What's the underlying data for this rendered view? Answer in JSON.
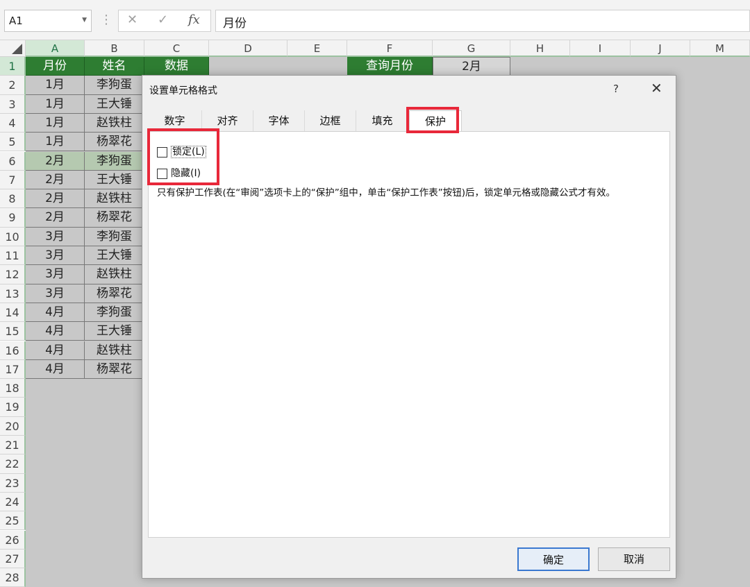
{
  "formula_bar": {
    "name_box": "A1",
    "cancel_icon": "✕",
    "enter_icon": "✓",
    "fx_label": "fx",
    "formula_value": "月份"
  },
  "columns": [
    "A",
    "B",
    "C",
    "D",
    "E",
    "F",
    "G",
    "H",
    "I",
    "J",
    "M"
  ],
  "rows": [
    "1",
    "2",
    "3",
    "4",
    "5",
    "6",
    "7",
    "8",
    "9",
    "10",
    "11",
    "12",
    "13",
    "14",
    "15",
    "16",
    "17",
    "18",
    "19",
    "20",
    "21",
    "22",
    "23",
    "24",
    "25",
    "26",
    "27",
    "28"
  ],
  "sheet": {
    "header_month": "月份",
    "header_name": "姓名",
    "header_data": "数据",
    "query_label": "查询月份",
    "query_value": "2月",
    "months": [
      "1月",
      "1月",
      "1月",
      "1月",
      "2月",
      "2月",
      "2月",
      "2月",
      "3月",
      "3月",
      "3月",
      "3月",
      "4月",
      "4月",
      "4月",
      "4月"
    ],
    "names": [
      "李狗蛋",
      "王大锤",
      "赵铁柱",
      "杨翠花",
      "李狗蛋",
      "王大锤",
      "赵铁柱",
      "杨翠花",
      "李狗蛋",
      "王大锤",
      "赵铁柱",
      "杨翠花",
      "李狗蛋",
      "王大锤",
      "赵铁柱",
      "杨翠花"
    ]
  },
  "dialog": {
    "title": "设置单元格格式",
    "help": "?",
    "close": "✕",
    "tabs": [
      "数字",
      "对齐",
      "字体",
      "边框",
      "填充",
      "保护"
    ],
    "active_tab": "保护",
    "locked_label": "锁定(L)",
    "locked_checked": false,
    "hidden_label": "隐藏(I)",
    "hidden_checked": false,
    "note": "只有保护工作表(在“审阅”选项卡上的“保护”组中，单击“保护工作表”按钮)后，锁定单元格或隐藏公式才有效。",
    "ok": "确定",
    "cancel": "取消"
  },
  "colors": {
    "header_green": "#2e7d32",
    "highlight_red": "#e8283a",
    "selection_green": "#d3e8d6",
    "ok_border": "#3a78d0"
  }
}
